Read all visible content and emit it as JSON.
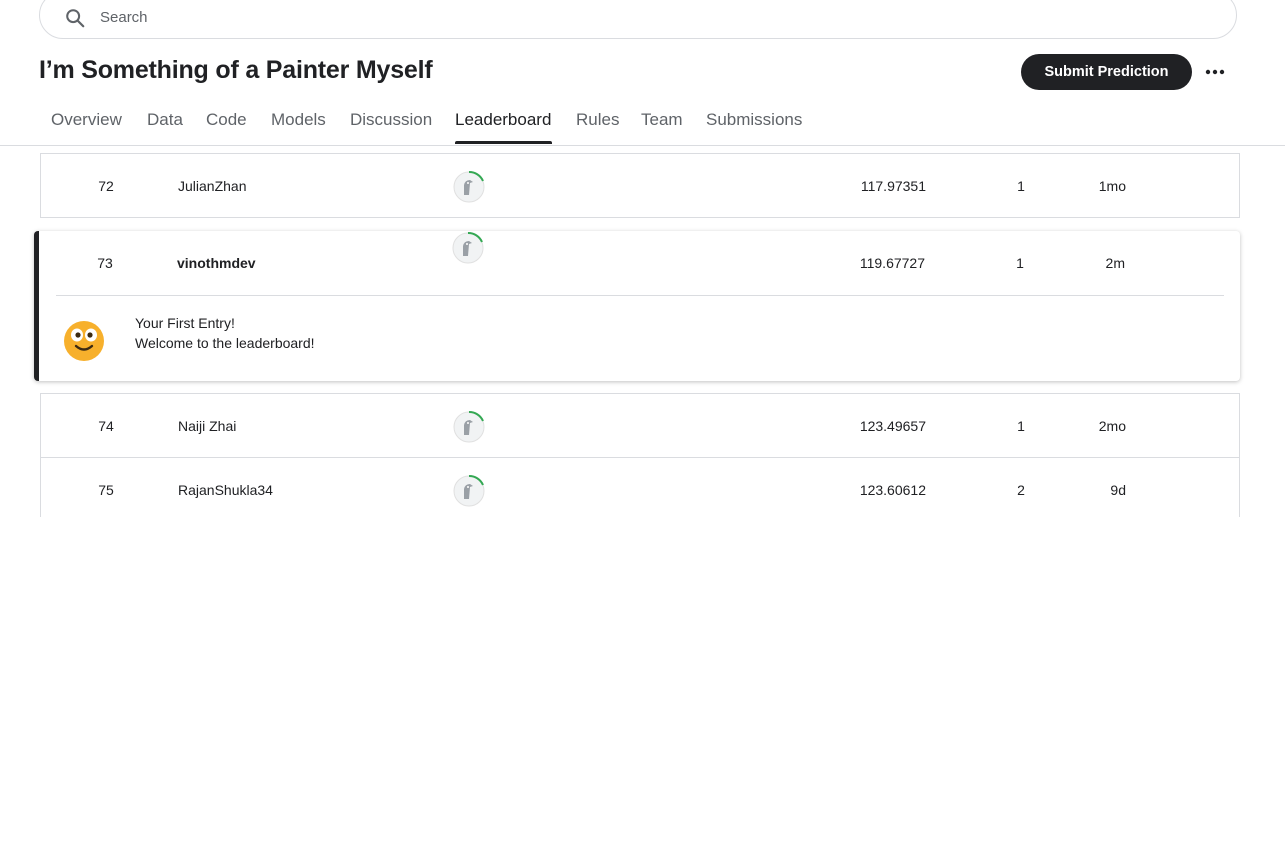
{
  "search": {
    "placeholder": "Search",
    "value": ""
  },
  "header": {
    "title": "I’m Something of a Painter Myself",
    "submit_label": "Submit Prediction",
    "more_label": "More options"
  },
  "tabs": [
    {
      "label": "Overview",
      "active": false
    },
    {
      "label": "Data",
      "active": false
    },
    {
      "label": "Code",
      "active": false
    },
    {
      "label": "Models",
      "active": false
    },
    {
      "label": "Discussion",
      "active": false
    },
    {
      "label": "Leaderboard",
      "active": true
    },
    {
      "label": "Rules",
      "active": false
    },
    {
      "label": "Team",
      "active": false
    },
    {
      "label": "Submissions",
      "active": false
    }
  ],
  "leaderboard": {
    "rows": [
      {
        "rank": "72",
        "team": "JulianZhan",
        "score": "117.97351",
        "entries": "1",
        "last": "1mo"
      },
      {
        "rank": "74",
        "team": "Naiji Zhai",
        "score": "123.49657",
        "entries": "1",
        "last": "2mo"
      },
      {
        "rank": "75",
        "team": "RajanShukla34",
        "score": "123.60612",
        "entries": "2",
        "last": "9d"
      }
    ],
    "current": {
      "rank": "73",
      "team": "vinothmdev",
      "score": "119.67727",
      "entries": "1",
      "last": "2m",
      "message_title": "Your First Entry!",
      "message_body": "Welcome to the leaderboard!"
    }
  },
  "colors": {
    "accent": "#202124",
    "progress_ring": "#20BEFF",
    "progress_green": "#34A853",
    "emoji": "#F7B02C"
  }
}
